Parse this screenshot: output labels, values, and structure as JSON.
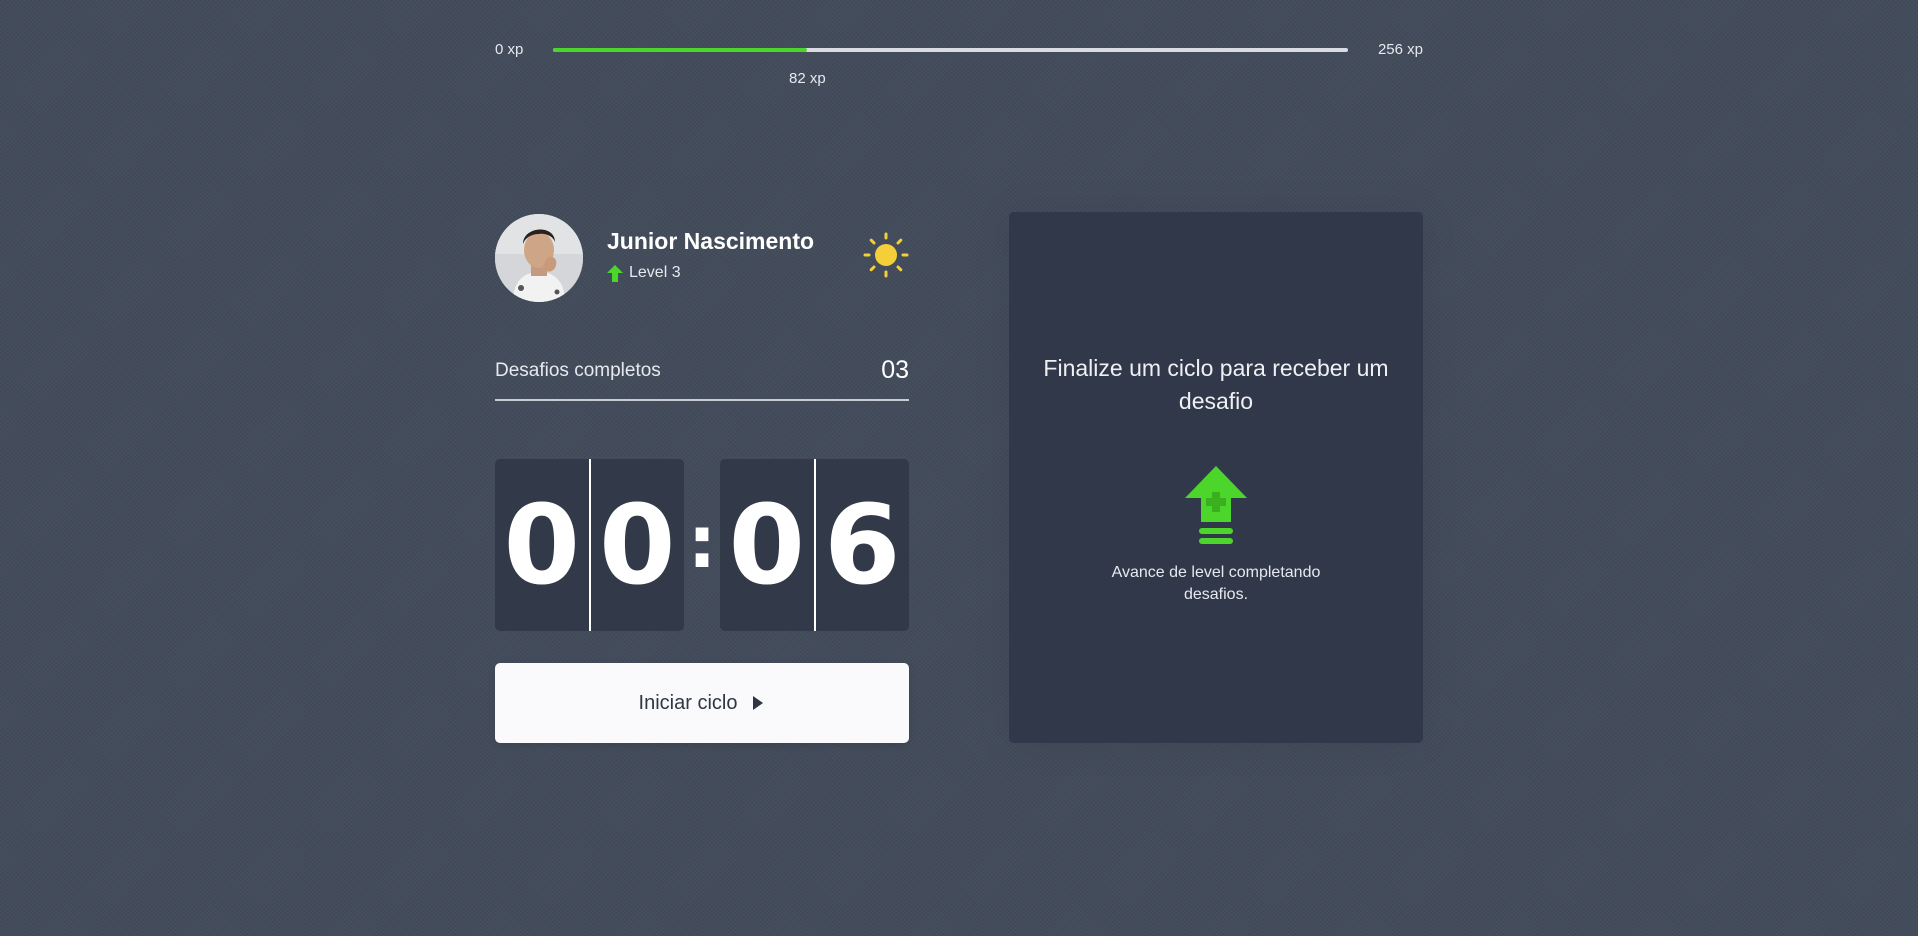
{
  "experience": {
    "min_label": "0 xp",
    "current_label": "82 xp",
    "max_label": "256 xp",
    "progress_percent": 32,
    "fill_color": "#4cd62b"
  },
  "profile": {
    "name": "Junior Nascimento",
    "level_label": "Level 3",
    "level_icon": "level-up-arrow-icon",
    "theme_icon": "sun-icon"
  },
  "challenges": {
    "completed_label": "Desafios completos",
    "completed_count": "03"
  },
  "countdown": {
    "minute_tens": "0",
    "minute_ones": "0",
    "separator": ":",
    "second_tens": "0",
    "second_ones": "6"
  },
  "actions": {
    "start_cycle_label": "Iniciar ciclo",
    "start_cycle_icon": "play-icon"
  },
  "challenge_card": {
    "title": "Finalize um ciclo para receber um desafio",
    "icon": "level-up-icon",
    "hint": "Avance de level completando desafios."
  },
  "colors": {
    "background": "#434c5b",
    "accent_green": "#4cd62b",
    "sun_yellow": "#f4cf3a",
    "panel": "#323949",
    "card": "#30384a"
  }
}
